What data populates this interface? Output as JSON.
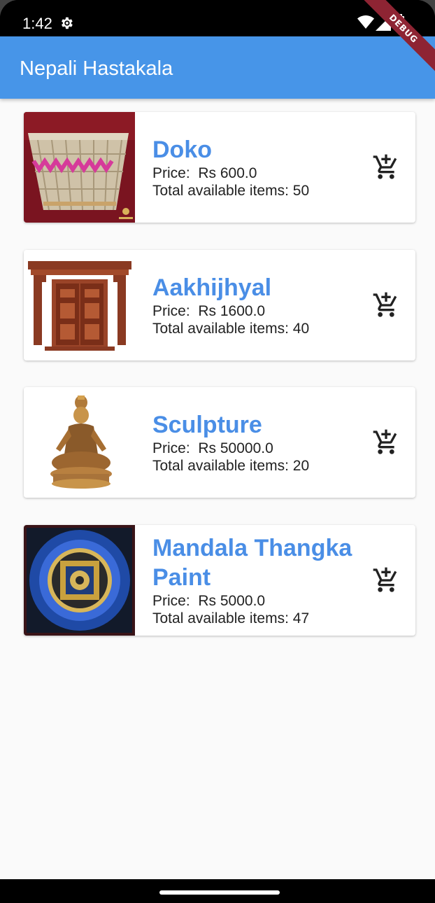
{
  "status_bar": {
    "time": "1:42"
  },
  "app_bar": {
    "title": "Nepali Hastakala",
    "debug_label": "DEBUG"
  },
  "products": [
    {
      "name": "Doko",
      "price_label": "Price:",
      "price": "Rs 600.0",
      "stock_label": "Total available items:",
      "stock": "50"
    },
    {
      "name": "Aakhijhyal",
      "price_label": "Price:",
      "price": "Rs 1600.0",
      "stock_label": "Total available items:",
      "stock": "40"
    },
    {
      "name": "Sculpture",
      "price_label": "Price:",
      "price": "Rs 50000.0",
      "stock_label": "Total available items:",
      "stock": "20"
    },
    {
      "name": "Mandala Thangka Paint",
      "price_label": "Price:",
      "price": "Rs 5000.0",
      "stock_label": "Total available items:",
      "stock": "47"
    }
  ],
  "icons": {
    "cart": "add-shopping-cart-icon",
    "settings": "gear-icon",
    "wifi": "wifi-icon",
    "signal": "cell-signal-icon",
    "battery": "battery-icon"
  },
  "colors": {
    "app_bar": "#4795e8",
    "product_name": "#4a8ee6",
    "debug_banner": "#8e2433"
  }
}
